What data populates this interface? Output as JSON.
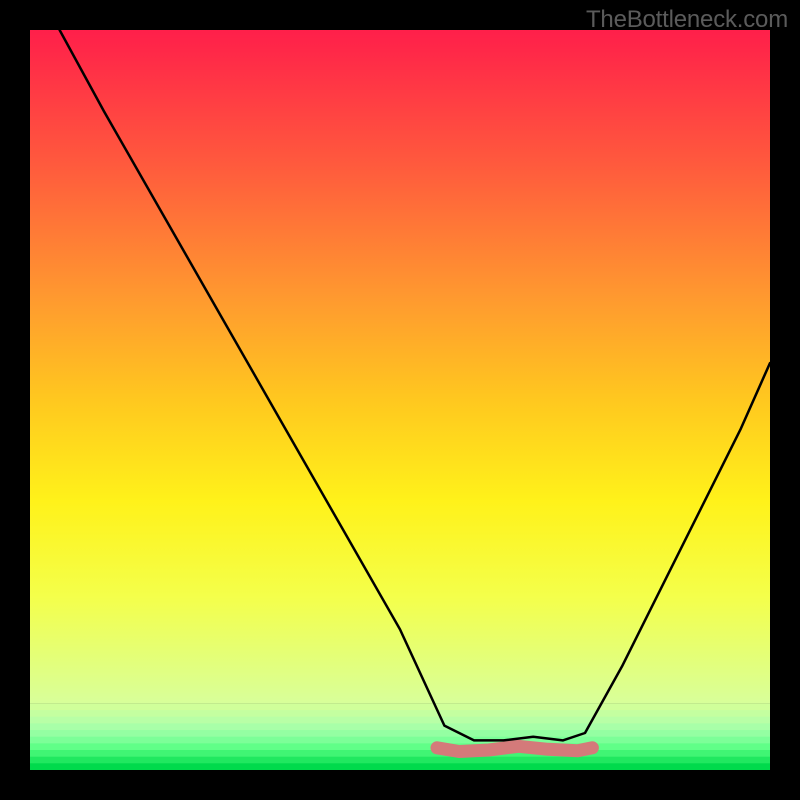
{
  "watermark": "TheBottleneck.com",
  "chart_data": {
    "type": "line",
    "title": "",
    "xlabel": "",
    "ylabel": "",
    "xlim": [
      0,
      100
    ],
    "ylim": [
      0,
      100
    ],
    "legend": false,
    "grid": false,
    "background": {
      "type": "layered-gradient",
      "notes": "Two stacked gradients: top 0-91% smooth red→orange→yellow→pale-green; bottom 91-100% horizontal green stripes of increasing saturation toward bottom.",
      "top_gradient_stops": [
        {
          "pos": 0.0,
          "color": "#ff1f4a"
        },
        {
          "pos": 0.2,
          "color": "#ff5a3d"
        },
        {
          "pos": 0.4,
          "color": "#ff9a2f"
        },
        {
          "pos": 0.55,
          "color": "#ffc81f"
        },
        {
          "pos": 0.7,
          "color": "#fff21a"
        },
        {
          "pos": 0.84,
          "color": "#f4ff4a"
        },
        {
          "pos": 1.0,
          "color": "#d8ff9a"
        }
      ],
      "bottom_stripes": [
        "#d0ff9a",
        "#c4ffa0",
        "#b8ffa6",
        "#a8ffa8",
        "#94ffa2",
        "#7cff98",
        "#60ff88",
        "#40f574",
        "#20e860",
        "#00da4c"
      ]
    },
    "series": [
      {
        "name": "bottleneck-curve",
        "color": "#000000",
        "stroke_width": 2.5,
        "notes": "V-shaped curve. Left branch starts top-left near x≈4 y≈100, descends steeply and nearly linearly to plateau. Plateau y≈4 from x≈56 to x≈75 (slight bump). Right branch rises with mild concave-up curvature to x≈100 y≈55.",
        "x": [
          4,
          10,
          18,
          26,
          34,
          42,
          50,
          56,
          60,
          64,
          68,
          72,
          75,
          80,
          86,
          92,
          96,
          100
        ],
        "y": [
          100,
          89,
          75,
          61,
          47,
          33,
          19,
          6,
          4,
          4,
          4.5,
          4,
          5,
          14,
          26,
          38,
          46,
          55
        ]
      },
      {
        "name": "plateau-marker",
        "type": "marker-band",
        "color": "#d47a7a",
        "notes": "Short salmon-colored thick rounded segment sitting on the plateau floor, roughly x 55–76 at y≈3.",
        "x": [
          55,
          58,
          62,
          66,
          70,
          74,
          76
        ],
        "y": [
          3,
          2.5,
          2.7,
          3.2,
          2.8,
          2.6,
          3
        ]
      }
    ]
  }
}
